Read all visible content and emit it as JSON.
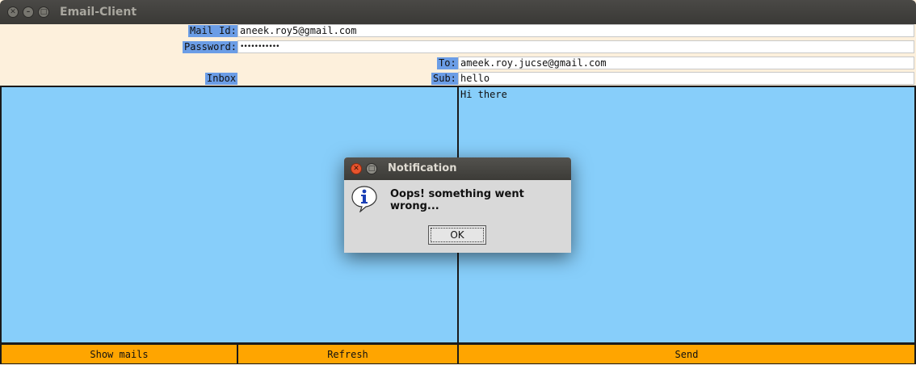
{
  "window": {
    "title": "Email-Client",
    "close_glyph": "✕",
    "min_glyph": "–",
    "max_glyph": "□"
  },
  "form": {
    "mail_id_label": "Mail Id:",
    "mail_id_value": "aneek.roy5@gmail.com",
    "password_label": "Password:",
    "password_value": "•••••••••••",
    "to_label": "To:",
    "to_value": "ameek.roy.jucse@gmail.com",
    "inbox_label": "Inbox",
    "sub_label": "Sub:",
    "sub_value": "hello"
  },
  "compose": {
    "body": "Hi there"
  },
  "buttons": {
    "show_mails": "Show mails",
    "refresh": "Refresh",
    "send": "Send"
  },
  "dialog": {
    "title": "Notification",
    "message": "Oops! something went wrong...",
    "ok_label": "OK",
    "close_glyph": "✕",
    "max_glyph": "□"
  },
  "colors": {
    "form_bg": "#fdf0dc",
    "label_bg": "#6b9de6",
    "pane_bg": "#87cefa",
    "button_bg": "#ffa500",
    "titlebar": "#3c3b37"
  }
}
